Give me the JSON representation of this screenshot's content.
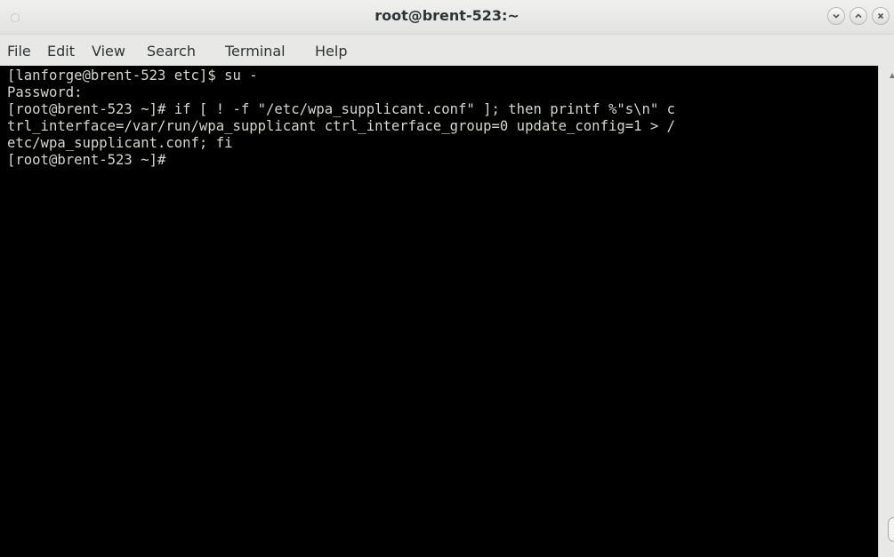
{
  "window": {
    "title": "root@brent-523:~"
  },
  "menubar": {
    "items": [
      "File",
      "Edit",
      "View",
      "Search",
      "Terminal",
      "Help"
    ]
  },
  "terminal": {
    "lines": [
      "[lanforge@brent-523 etc]$ su -",
      "Password:",
      "[root@brent-523 ~]# if [ ! -f \"/etc/wpa_supplicant.conf\" ]; then printf %\"s\\n\" c",
      "trl_interface=/var/run/wpa_supplicant ctrl_interface_group=0 update_config=1 > /",
      "etc/wpa_supplicant.conf; fi",
      "[root@brent-523 ~]# "
    ]
  },
  "icons": {
    "minimize": "chevron-down-icon",
    "maximize": "chevron-up-icon",
    "close": "close-icon"
  },
  "colors": {
    "terminal_background": "#000000",
    "terminal_foreground": "#d3d7cf",
    "chrome": "#e8e8e7"
  }
}
